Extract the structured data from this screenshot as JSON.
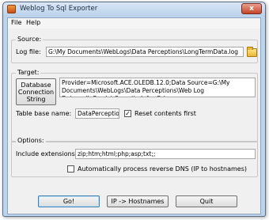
{
  "window": {
    "title": "Weblog To Sql Exporter",
    "close_glyph": "x"
  },
  "menu": {
    "items": [
      "File",
      "Help"
    ]
  },
  "source": {
    "group_label": "Source:",
    "logfile_label": "Log file:",
    "logfile_value": "G:\\My Documents\\WebLogs\\Data Perceptions\\LongTermData.log"
  },
  "target": {
    "group_label": "Target:",
    "conn_button_label": "Database Connection String",
    "conn_value": "Provider=Microsoft.ACE.OLEDB.12.0;Data Source=G:\\My Documents\\WebLogs\\Data Perceptions\\Web Log Data.mdb;Persist Security Info=False",
    "table_label": "Table base name:",
    "table_value": "DataPerception",
    "reset_label": "Reset contents first",
    "reset_checked": "✓"
  },
  "options": {
    "group_label": "Options:",
    "extensions_label": "Include extensions:",
    "extensions_value": "zip;htm;html;php;asp;txt;;",
    "reverse_dns_label": "Automatically process reverse DNS (IP to hostnames)"
  },
  "buttons": {
    "go": "Go!",
    "ip": "IP -> Hostnames",
    "quit": "Quit"
  }
}
